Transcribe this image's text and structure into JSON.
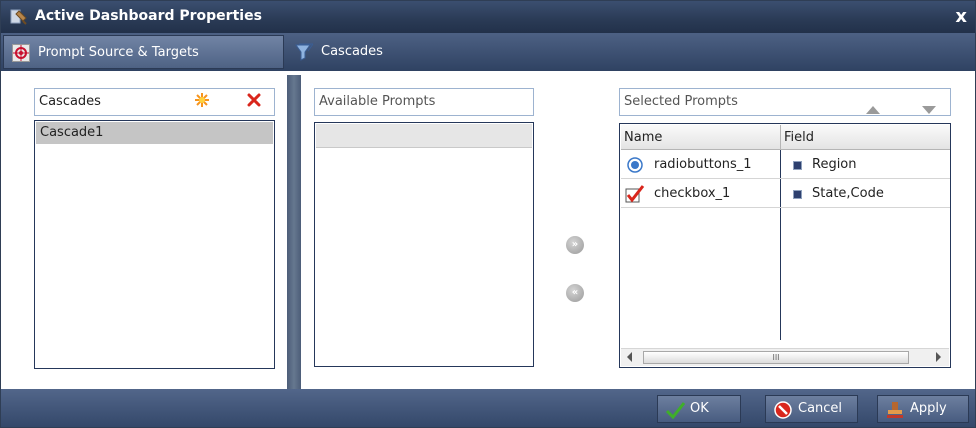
{
  "window": {
    "title": "Active Dashboard Properties",
    "close_glyph": "x"
  },
  "tabs": [
    {
      "label": "Prompt Source & Targets",
      "icon": "target-icon"
    },
    {
      "label": "Cascades",
      "icon": "funnel-icon"
    }
  ],
  "cascades_panel": {
    "header": "Cascades",
    "items": [
      {
        "label": "Cascade1",
        "selected": true
      }
    ]
  },
  "available_panel": {
    "header": "Available Prompts",
    "items": []
  },
  "move_buttons": {
    "add": "»",
    "remove": "«"
  },
  "selected_panel": {
    "header": "Selected Prompts",
    "columns": [
      "Name",
      "Field"
    ],
    "rows": [
      {
        "type_icon": "radio-icon",
        "name": "radiobuttons_1",
        "field": "Region"
      },
      {
        "type_icon": "checkbox-icon",
        "name": "checkbox_1",
        "field": "State,Code"
      }
    ],
    "scroll_grip": "III"
  },
  "footer": {
    "ok": "OK",
    "cancel": "Cancel",
    "apply": "Apply"
  },
  "colors": {
    "title_bar": "#2a3a55",
    "accent_orange": "#f7941d",
    "delete_red": "#d9261c",
    "ok_green": "#3fae2a"
  }
}
